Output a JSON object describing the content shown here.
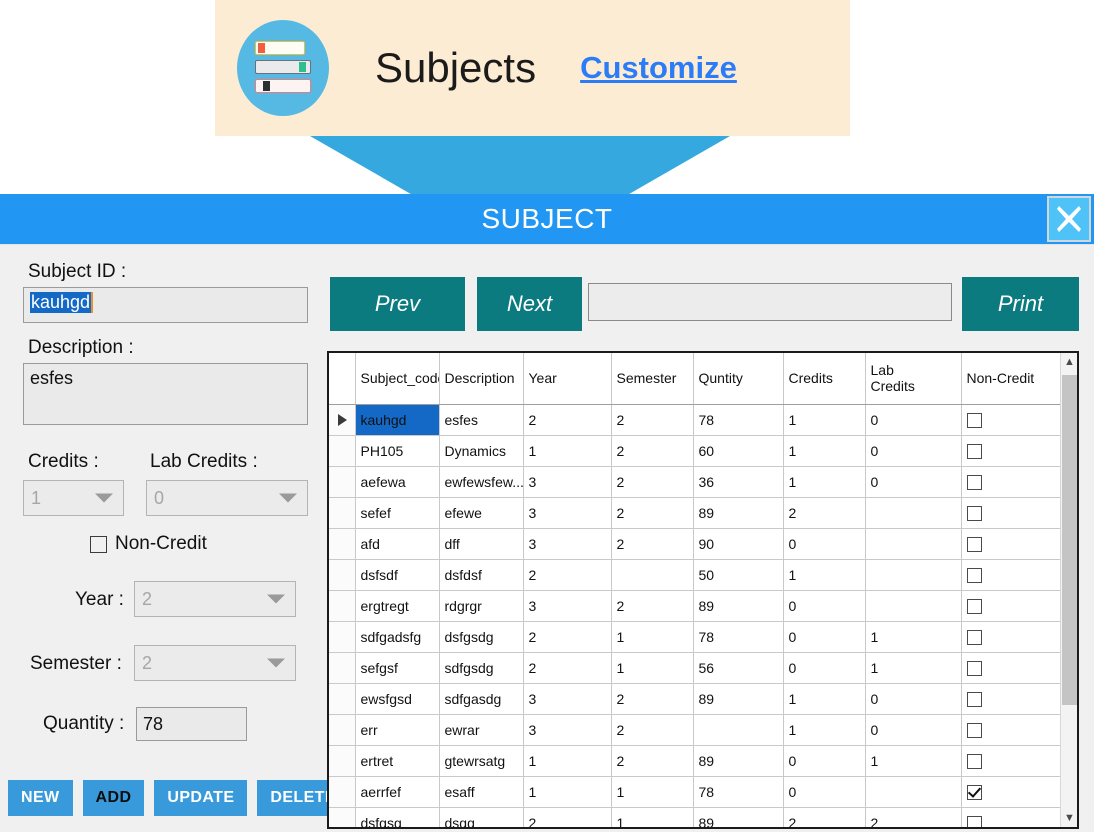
{
  "banner": {
    "logo_icon": "books-stack-icon",
    "title": "Subjects",
    "customize_label": "Customize",
    "bg_color": "#fcecd3",
    "accent_color": "#35a8e0"
  },
  "window": {
    "title": "SUBJECT",
    "titlebar_color": "#2196f3",
    "close_label": "X"
  },
  "form": {
    "subject_id_label": "Subject ID :",
    "subject_id_value": "kauhgd",
    "description_label": "Description :",
    "description_value": "esfes",
    "credits_label": "Credits :",
    "credits_value": "1",
    "lab_credits_label": "Lab Credits :",
    "lab_credits_value": "0",
    "non_credit_label": "Non-Credit",
    "non_credit_checked": false,
    "year_label": "Year :",
    "year_value": "2",
    "semester_label": "Semester :",
    "semester_value": "2",
    "quantity_label": "Quantity :",
    "quantity_value": "78",
    "buttons": [
      {
        "label": "NEW",
        "style": "light"
      },
      {
        "label": "ADD",
        "style": "dark"
      },
      {
        "label": "UPDATE",
        "style": "light"
      },
      {
        "label": "DELETE",
        "style": "light"
      }
    ],
    "button_color": "#389ada"
  },
  "toolbar": {
    "prev_label": "Prev",
    "next_label": "Next",
    "print_label": "Print",
    "search_value": "",
    "search_placeholder": "",
    "button_color": "#0c7b7f"
  },
  "grid": {
    "columns": [
      "",
      "Subject_code",
      "Description",
      "Year",
      "Semester",
      "Quntity",
      "Credits",
      "Lab Credits",
      "Non-Credit"
    ],
    "selected_row_index": 0,
    "rows": [
      {
        "code": "kauhgd",
        "description": "esfes",
        "year": "2",
        "semester": "2",
        "quantity": "78",
        "credits": "1",
        "lab_credits": "0",
        "non_credit": false
      },
      {
        "code": "PH105",
        "description": "Dynamics",
        "year": "1",
        "semester": "2",
        "quantity": "60",
        "credits": "1",
        "lab_credits": "0",
        "non_credit": false
      },
      {
        "code": "aefewa",
        "description": "ewfewsfew...",
        "year": "3",
        "semester": "2",
        "quantity": "36",
        "credits": "1",
        "lab_credits": "0",
        "non_credit": false
      },
      {
        "code": "sefef",
        "description": "efewe",
        "year": "3",
        "semester": "2",
        "quantity": "89",
        "credits": "2",
        "lab_credits": "",
        "non_credit": false
      },
      {
        "code": "afd",
        "description": "dff",
        "year": "3",
        "semester": "2",
        "quantity": "90",
        "credits": "0",
        "lab_credits": "",
        "non_credit": false
      },
      {
        "code": "dsfsdf",
        "description": "dsfdsf",
        "year": "2",
        "semester": "",
        "quantity": "50",
        "credits": "1",
        "lab_credits": "",
        "non_credit": false
      },
      {
        "code": "ergtregt",
        "description": "rdgrgr",
        "year": "3",
        "semester": "2",
        "quantity": "89",
        "credits": "0",
        "lab_credits": "",
        "non_credit": false
      },
      {
        "code": "sdfgadsfg",
        "description": "dsfgsdg",
        "year": "2",
        "semester": "1",
        "quantity": "78",
        "credits": "0",
        "lab_credits": "1",
        "non_credit": false
      },
      {
        "code": "sefgsf",
        "description": "sdfgsdg",
        "year": "2",
        "semester": "1",
        "quantity": "56",
        "credits": "0",
        "lab_credits": "1",
        "non_credit": false
      },
      {
        "code": "ewsfgsd",
        "description": "sdfgasdg",
        "year": "3",
        "semester": "2",
        "quantity": "89",
        "credits": "1",
        "lab_credits": "0",
        "non_credit": false
      },
      {
        "code": "err",
        "description": "ewrar",
        "year": "3",
        "semester": "2",
        "quantity": "",
        "credits": "1",
        "lab_credits": "0",
        "non_credit": false
      },
      {
        "code": "ertret",
        "description": "gtewrsatg",
        "year": "1",
        "semester": "2",
        "quantity": "89",
        "credits": "0",
        "lab_credits": "1",
        "non_credit": false
      },
      {
        "code": "aerrfef",
        "description": "esaff",
        "year": "1",
        "semester": "1",
        "quantity": "78",
        "credits": "0",
        "lab_credits": "",
        "non_credit": true
      },
      {
        "code": "dsfgsg",
        "description": "dsgg",
        "year": "2",
        "semester": "1",
        "quantity": "89",
        "credits": "2",
        "lab_credits": "2",
        "non_credit": false
      }
    ]
  }
}
